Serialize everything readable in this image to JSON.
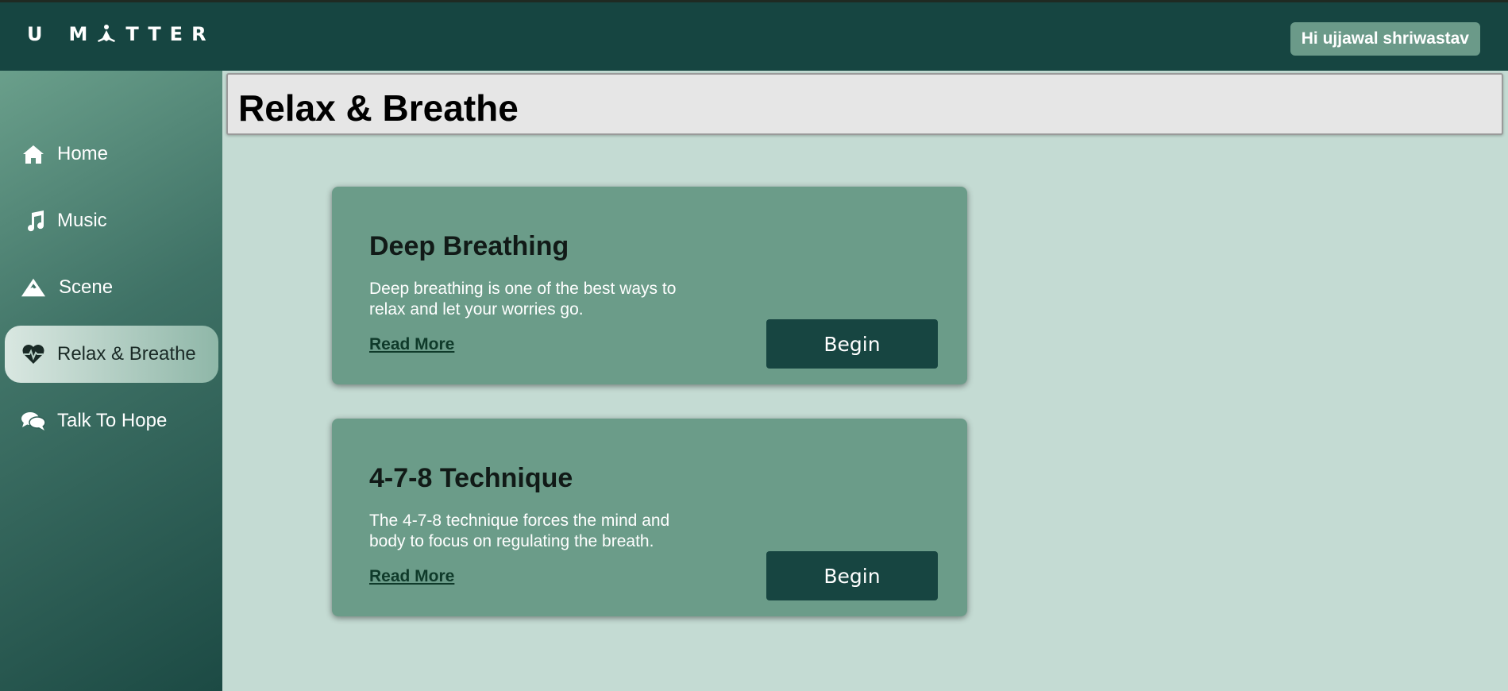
{
  "app": {
    "logo_text": "U MATTER",
    "logo_icon": "meditation-icon",
    "greeting": "Hi ujjawal shriwastav"
  },
  "sidebar": {
    "items": [
      {
        "label": "Home",
        "icon": "home-icon",
        "active": false
      },
      {
        "label": "Music",
        "icon": "music-icon",
        "active": false
      },
      {
        "label": "Scene",
        "icon": "mountain-icon",
        "active": false
      },
      {
        "label": "Relax & Breathe",
        "icon": "heartbeat-icon",
        "active": true
      },
      {
        "label": "Talk To Hope",
        "icon": "chat-icon",
        "active": false
      }
    ]
  },
  "page": {
    "title": "Relax & Breathe"
  },
  "cards": [
    {
      "title": "Deep Breathing",
      "description": "Deep breathing is one of the best ways to relax and let your worries go.",
      "read_more": "Read More",
      "button": "Begin"
    },
    {
      "title": "4-7-8 Technique",
      "description": "The 4-7-8 technique forces the mind and body to focus on regulating the breath.",
      "read_more": "Read More",
      "button": "Begin"
    }
  ],
  "colors": {
    "topbar": "#164541",
    "content_bg": "#c4dbd3",
    "card_bg": "#6b9c89",
    "button_bg": "#174541",
    "badge_bg": "#6b9a89"
  }
}
